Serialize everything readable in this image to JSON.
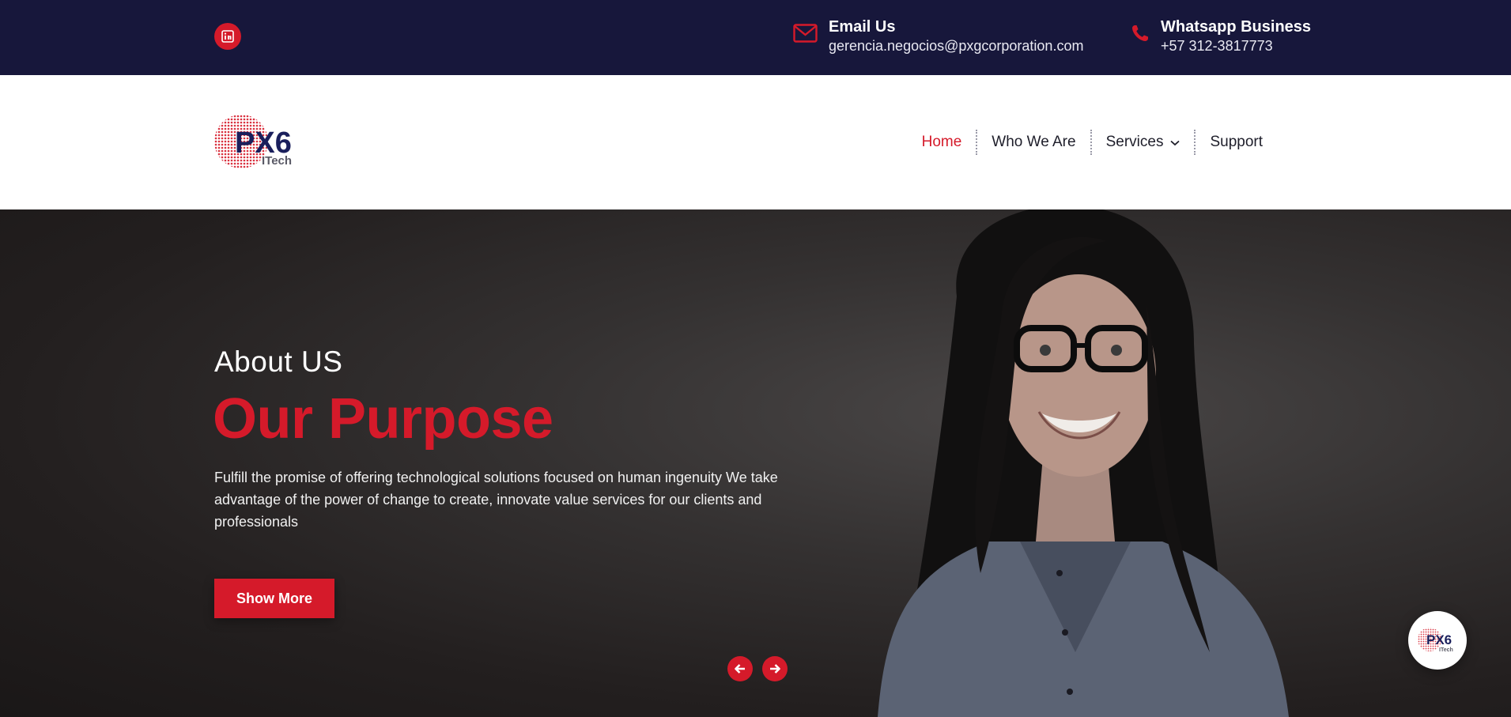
{
  "topbar": {
    "social": [
      {
        "icon": "linkedin-icon"
      }
    ],
    "email": {
      "title": "Email Us",
      "value": "gerencia.negocios@pxgcorporation.com",
      "icon": "envelope-icon"
    },
    "whatsapp": {
      "title": "Whatsapp Business",
      "value": "+57 312-3817773",
      "icon": "phone-icon"
    }
  },
  "header": {
    "logo": {
      "text_main": "PX6",
      "text_sub": "ITech"
    },
    "nav": [
      {
        "label": "Home",
        "active": true
      },
      {
        "label": "Who We Are"
      },
      {
        "label": "Services",
        "has_dropdown": true
      },
      {
        "label": "Support"
      }
    ]
  },
  "hero": {
    "kicker": "About US",
    "headline": "Our Purpose",
    "description": "Fulfill the promise of offering technological solutions focused on human ingenuity We take advantage of the power of change to create, innovate value services for our clients and professionals",
    "button_label": "Show More",
    "prev_icon": "arrow-left-icon",
    "next_icon": "arrow-right-icon"
  },
  "floating": {
    "logo_main": "PX6",
    "logo_sub": "ITech"
  },
  "colors": {
    "accent": "#d51a2a",
    "topbar": "#17173b",
    "navy": "#1a1f5c"
  }
}
